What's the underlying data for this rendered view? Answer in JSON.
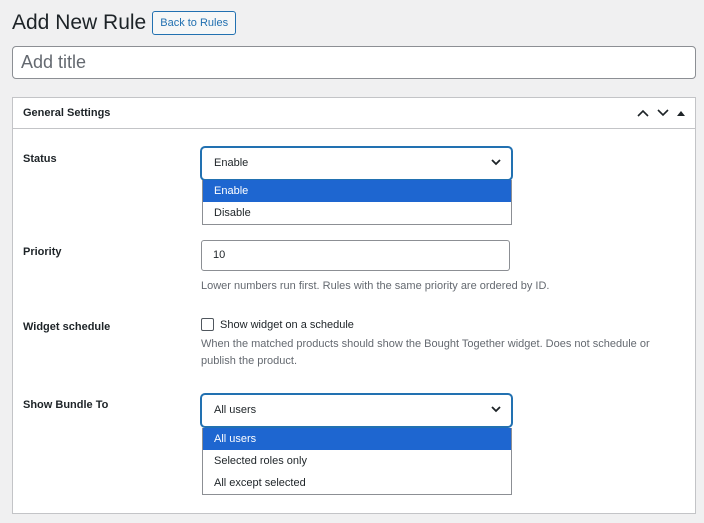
{
  "header": {
    "title": "Add New Rule",
    "back_label": "Back to Rules"
  },
  "title_input": {
    "placeholder": "Add title",
    "value": ""
  },
  "postbox": {
    "title": "General Settings"
  },
  "status": {
    "label": "Status",
    "selected": "Enable",
    "options": [
      "Enable",
      "Disable"
    ]
  },
  "priority": {
    "label": "Priority",
    "value": "10",
    "description": "Lower numbers run first. Rules with the same priority are ordered by ID."
  },
  "widget_schedule": {
    "label": "Widget schedule",
    "checkbox_label": "Show widget on a schedule",
    "checked": false,
    "description_line1": "When the matched products should show the Bought Together widget. Does not schedule or",
    "description_line2": "publish the product."
  },
  "show_bundle_to": {
    "label": "Show Bundle To",
    "selected": "All users",
    "options": [
      "All users",
      "Selected roles only",
      "All except selected"
    ]
  },
  "colors": {
    "accent": "#2271b1",
    "selected_option": "#1e66d0",
    "background": "#f0f0f1"
  }
}
